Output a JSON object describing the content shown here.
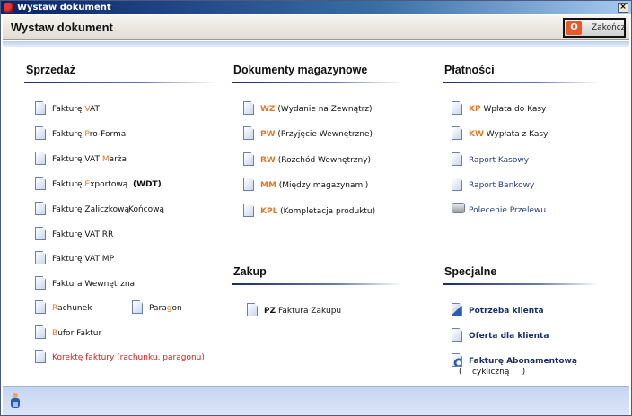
{
  "window": {
    "title": "Wystaw dokument",
    "close": "×"
  },
  "header": {
    "title": "Wystaw dokument",
    "end_button": "Zakończ",
    "end_icon": "power-icon"
  },
  "colors": {
    "accent": "#e07a2a",
    "red": "#cc2020",
    "link": "#1f3f7a",
    "navy": "#16306a"
  },
  "sections": [
    {
      "id": "sprzedaz",
      "title": "Sprzedaż",
      "items": [
        {
          "icon": "document-icon",
          "parts": [
            [
              "Fakturę ",
              ""
            ],
            [
              "V",
              "o"
            ],
            [
              "AT",
              ""
            ]
          ]
        },
        {
          "icon": "document-icon",
          "parts": [
            [
              "Fakturę ",
              ""
            ],
            [
              "P",
              "o"
            ],
            [
              "ro-Forma",
              ""
            ]
          ]
        },
        {
          "icon": "document-icon",
          "parts": [
            [
              "Fakturę VAT ",
              ""
            ],
            [
              "M",
              "o"
            ],
            [
              "arża",
              ""
            ]
          ]
        },
        {
          "icon": "document-icon",
          "parts": [
            [
              "Fakturę ",
              ""
            ],
            [
              "E",
              "o"
            ],
            [
              "xportową  ",
              ""
            ],
            [
              "(WDT)",
              "b"
            ]
          ]
        },
        {
          "icon": "document-icon",
          "parts": [
            [
              "Fakturę Zaliczkową",
              ""
            ]
          ]
        },
        {
          "icon": "none",
          "parts": [
            [
              "Końcową",
              ""
            ]
          ]
        },
        {
          "icon": "document-icon",
          "parts": [
            [
              "Fakturę VAT RR",
              ""
            ]
          ]
        },
        {
          "icon": "document-icon",
          "parts": [
            [
              "Fakturę VAT MP",
              ""
            ]
          ]
        },
        {
          "icon": "document-icon",
          "parts": [
            [
              "Faktura Wewnętrzna",
              ""
            ]
          ]
        },
        {
          "icon": "document-icon",
          "parts": [
            [
              "R",
              "o"
            ],
            [
              "achunek",
              ""
            ]
          ]
        },
        {
          "icon": "document-icon",
          "parts": [
            [
              "Para",
              ""
            ],
            [
              "g",
              "o"
            ],
            [
              "on",
              ""
            ]
          ]
        },
        {
          "icon": "document-icon",
          "parts": [
            [
              "B",
              "o"
            ],
            [
              "ufor Faktur",
              ""
            ]
          ]
        },
        {
          "icon": "document-icon",
          "parts": [
            [
              "Korektę faktury (rachunku, paragonu)",
              "red"
            ]
          ]
        }
      ]
    },
    {
      "id": "magazyn",
      "title": "Dokumenty magazynowe",
      "items": [
        {
          "icon": "document-icon",
          "parts": [
            [
              "WZ",
              "ob"
            ],
            [
              " (Wydanie na Zewnątrz)",
              ""
            ]
          ]
        },
        {
          "icon": "document-icon",
          "parts": [
            [
              "PW",
              "ob"
            ],
            [
              " (Przyjęcie Wewnętrzne)",
              ""
            ]
          ]
        },
        {
          "icon": "document-icon",
          "parts": [
            [
              "RW",
              "ob"
            ],
            [
              " (Rozchód Wewnętrzny)",
              ""
            ]
          ]
        },
        {
          "icon": "document-icon",
          "parts": [
            [
              "MM",
              "ob"
            ],
            [
              " (Między magazynami)",
              ""
            ]
          ]
        },
        {
          "icon": "document-icon",
          "parts": [
            [
              "KPL",
              "ob"
            ],
            [
              " (Kompletacja produktu)",
              ""
            ]
          ]
        }
      ]
    },
    {
      "id": "zakup",
      "title": "Zakup",
      "items": [
        {
          "icon": "document-icon",
          "parts": [
            [
              "PZ",
              "b"
            ],
            [
              " Faktura Zakupu",
              ""
            ]
          ]
        }
      ]
    },
    {
      "id": "platnosci",
      "title": "Płatności",
      "items": [
        {
          "icon": "document-icon",
          "parts": [
            [
              "KP",
              "ob"
            ],
            [
              " Wpłata do Kasy",
              ""
            ]
          ]
        },
        {
          "icon": "document-icon",
          "parts": [
            [
              "KW",
              "ob"
            ],
            [
              " Wypłata z Kasy",
              ""
            ]
          ]
        },
        {
          "icon": "document-icon",
          "parts": [
            [
              "Raport Kasowy",
              "blue"
            ]
          ]
        },
        {
          "icon": "document-icon",
          "parts": [
            [
              "Raport Bankowy",
              "blue"
            ]
          ]
        },
        {
          "icon": "printer-icon",
          "parts": [
            [
              "Polecenie Przelewu",
              "blue"
            ]
          ]
        }
      ]
    },
    {
      "id": "specjalne",
      "title": "Specjalne",
      "items": [
        {
          "icon": "client-document-icon",
          "parts": [
            [
              "Potrzeba klienta",
              "navy"
            ]
          ]
        },
        {
          "icon": "document-icon",
          "parts": [
            [
              "Oferta dla klienta",
              "navy"
            ]
          ]
        },
        {
          "icon": "clock-document-icon",
          "parts": [
            [
              "Fakturę Abonamentową",
              "navy"
            ]
          ]
        },
        {
          "icon": "none",
          "parts": [
            [
              "(    cykliczną     )",
              ""
            ]
          ]
        }
      ]
    }
  ],
  "footer": {
    "icon": "user-icon"
  }
}
